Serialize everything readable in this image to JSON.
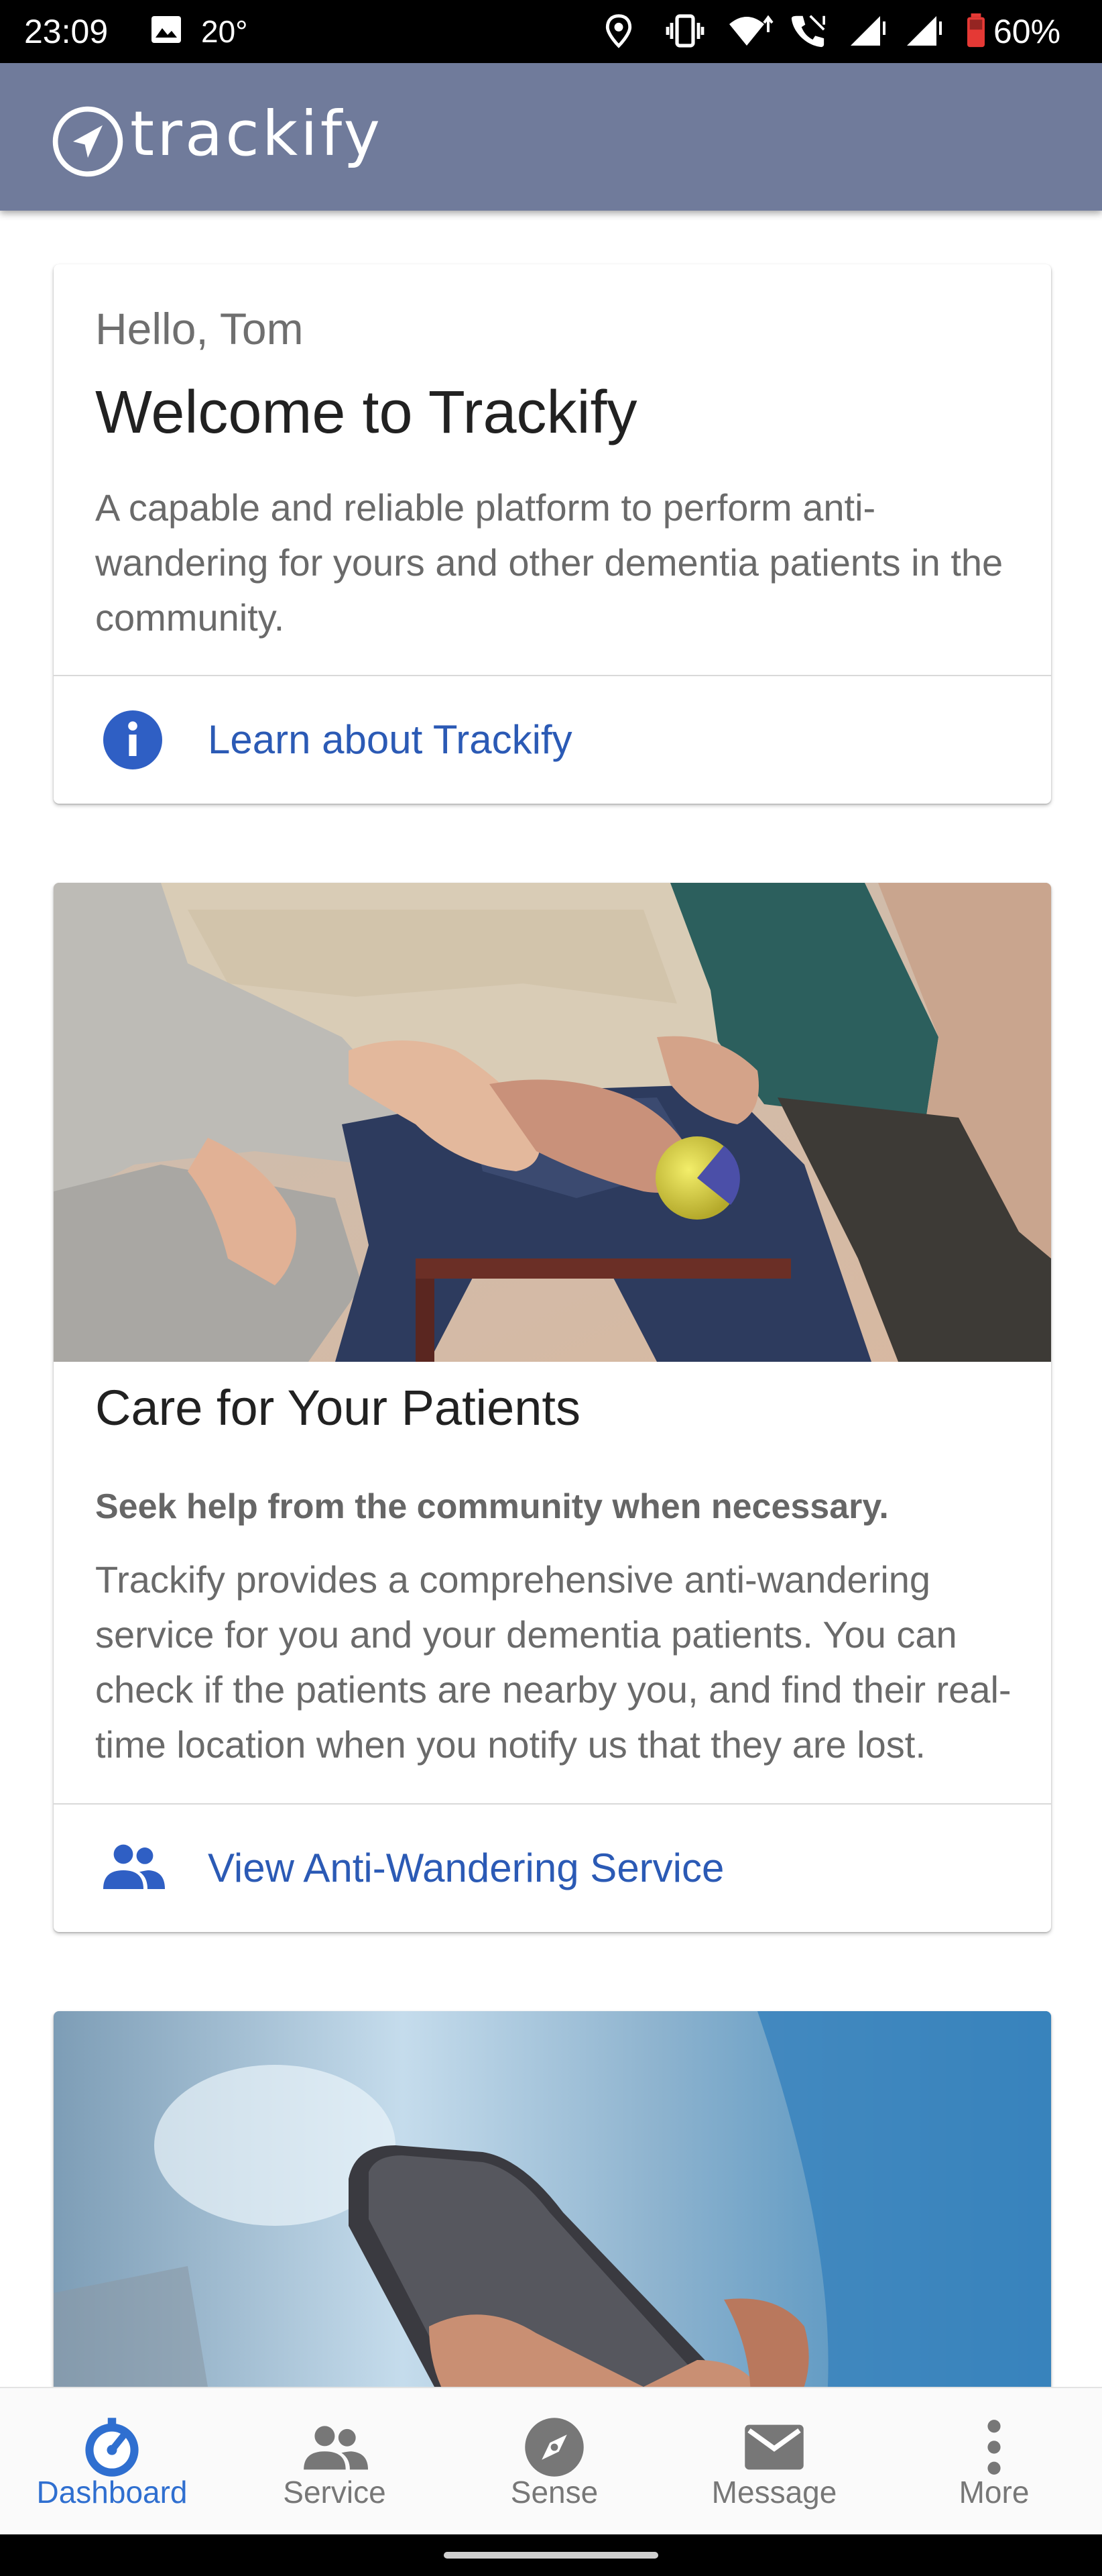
{
  "status_bar": {
    "time": "23:09",
    "temperature": "20°",
    "battery": "60%",
    "icons": [
      "gallery-icon",
      "location-icon",
      "vibrate-icon",
      "wifi-icon",
      "call-icon",
      "signal-icon",
      "signal-icon",
      "battery-icon"
    ]
  },
  "app_bar": {
    "brand": "trackify",
    "logo_icon": "navigation-arrow-icon",
    "background": "#707b9b"
  },
  "welcome_card": {
    "greeting": "Hello, Tom",
    "title": "Welcome to Trackify",
    "body_lines": [
      "A capable and reliable platform to perform anti-",
      "wandering for yours and other dementia patients in the",
      "community."
    ],
    "action": {
      "icon": "info-icon",
      "label": "Learn about Trackify"
    }
  },
  "care_card": {
    "image": "photo of caregiver holding elderly patient's hands",
    "title": "Care for Your Patients",
    "subtitle": "Seek help from the community when necessary.",
    "body_lines": [
      "Trackify provides a comprehensive anti-wandering",
      "service for you and your dementia patients. You can",
      "check if the patients are nearby you, and find their real-",
      "time location when you notify us that they are lost."
    ],
    "action": {
      "icon": "people-icon",
      "label": "View Anti-Wandering Service"
    }
  },
  "third_card": {
    "image": "photo of hand holding smartphone"
  },
  "bottom_nav": {
    "items": [
      {
        "label": "Dashboard",
        "icon": "dashboard-icon",
        "active": true
      },
      {
        "label": "Service",
        "icon": "people-icon",
        "active": false
      },
      {
        "label": "Sense",
        "icon": "compass-icon",
        "active": false
      },
      {
        "label": "Message",
        "icon": "mail-icon",
        "active": false
      },
      {
        "label": "More",
        "icon": "more-vertical-icon",
        "active": false
      }
    ]
  },
  "colors": {
    "accent": "#2f6fd0",
    "link": "#2b5ab5",
    "app_bar": "#707b9b"
  }
}
